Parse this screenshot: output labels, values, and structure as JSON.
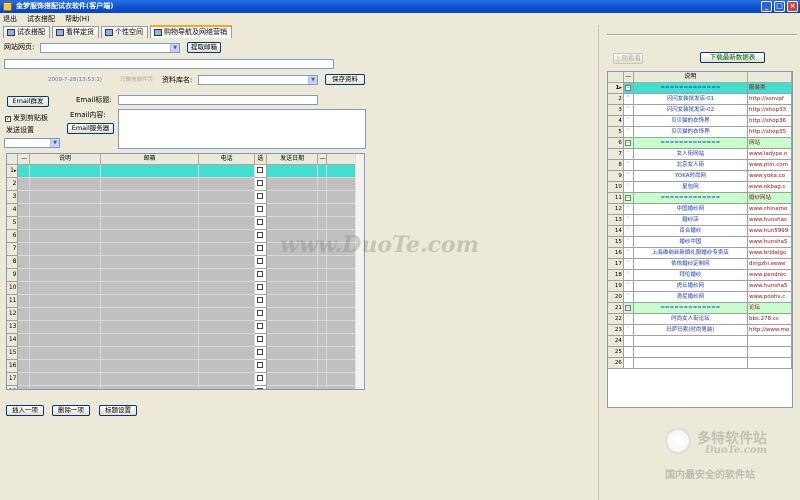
{
  "window": {
    "title": "金梦服饰搭配试衣软件(客户端)",
    "minimize": "_",
    "maximize": "□",
    "close": "×"
  },
  "menu": [
    "退出",
    "试衣搭配",
    "帮助(H)"
  ],
  "tabs": [
    {
      "label": "试衣搭配",
      "active": false
    },
    {
      "label": "看样定货",
      "active": false
    },
    {
      "label": "个性空间",
      "active": false
    },
    {
      "label": "购物导航及网络营销",
      "active": true
    }
  ],
  "form": {
    "site_label": "网站网页:",
    "fetch_email_button": "提取邮箱",
    "datetime_text": "2009-7-28(13:53:1)",
    "disabled_link": "只做信邮件页",
    "db_name_label": "资料库名:",
    "save_button": "保存资料",
    "email_send_button": "Email群发",
    "email_title_label": "Email标题:",
    "email_content_label": "Email内容:",
    "copy_clipboard_label": "发到剪贴板",
    "copy_clipboard_checked": true,
    "send_settings_label": "发送设置",
    "email_server_button": "Email服务器"
  },
  "left_grid": {
    "columns": [
      "说明",
      "邮箱",
      "电话",
      "选",
      "发送日期"
    ],
    "row_count": 21
  },
  "bottom_buttons": [
    "插入一项",
    "删除一项",
    "标题设置"
  ],
  "right_panel": {
    "disabled_button": "上网看看",
    "download_button": "下载最新数据表",
    "column_header": "说明",
    "rows": [
      {
        "n": "1",
        "group": true,
        "desc": "=============",
        "url": "服装类"
      },
      {
        "n": "2",
        "desc": "闪闪女装批发店-01",
        "url": "http://ssnvpf"
      },
      {
        "n": "3",
        "desc": "闪闪女装批发店-02",
        "url": "http://shop33"
      },
      {
        "n": "4",
        "desc": "贝贝猫的衣饰界",
        "url": "http://shop36"
      },
      {
        "n": "5",
        "desc": "贝贝猫的衣饰界",
        "url": "http://shop35"
      },
      {
        "n": "6",
        "group": true,
        "desc": "=============",
        "url": "网站"
      },
      {
        "n": "7",
        "desc": "女人街网站",
        "url": "www.ladype.n"
      },
      {
        "n": "8",
        "desc": "北京女人街",
        "url": "www.ptin.com"
      },
      {
        "n": "9",
        "desc": "YOKA时尚网",
        "url": "www.yoka.co"
      },
      {
        "n": "10",
        "desc": "星包网",
        "url": "www.okbag.c"
      },
      {
        "n": "11",
        "group": true,
        "desc": "=============",
        "url": "婚纱网站"
      },
      {
        "n": "12",
        "desc": "中国婚纱网",
        "url": "www.chinamo"
      },
      {
        "n": "13",
        "desc": "婚纱店",
        "url": "www.hunshac"
      },
      {
        "n": "14",
        "desc": "百合婚纱",
        "url": "www.hun5999"
      },
      {
        "n": "15",
        "desc": "婚纱中国",
        "url": "www.hunsha5"
      },
      {
        "n": "16",
        "desc": "上海维纳丝新娘礼服婚纱专卖店",
        "url": "www.bridalgo"
      },
      {
        "n": "17",
        "desc": "依依婚纱定制网",
        "url": "dingzhi.eewe"
      },
      {
        "n": "18",
        "desc": "拜伦婚纱",
        "url": "www.pendrec"
      },
      {
        "n": "19",
        "desc": "虎丘婚纱网",
        "url": "www.hunsha5"
      },
      {
        "n": "20",
        "desc": "滴尼婚纱网",
        "url": "www.poohs.c"
      },
      {
        "n": "21",
        "group": true,
        "desc": "=============",
        "url": "论坛"
      },
      {
        "n": "22",
        "desc": "时尚女人街论坛",
        "url": "bbs.278.cc"
      },
      {
        "n": "23",
        "desc": "玛萨玛索(时尚男装)",
        "url": "http://www.mo"
      },
      {
        "n": "24",
        "desc": "",
        "url": ""
      },
      {
        "n": "25",
        "desc": "",
        "url": ""
      },
      {
        "n": "26",
        "desc": "",
        "url": ""
      }
    ]
  },
  "watermark": {
    "center": "www.DuoTe.com",
    "logo_cn": "多特软件站",
    "logo_en": "DuoTe.com",
    "slogan": "国内最安全的软件站"
  },
  "colors": {
    "selection": "#40e0d0",
    "group_row": "#c6ffcc",
    "desc_text": "#1d39c4",
    "url_text": "#a01010"
  }
}
